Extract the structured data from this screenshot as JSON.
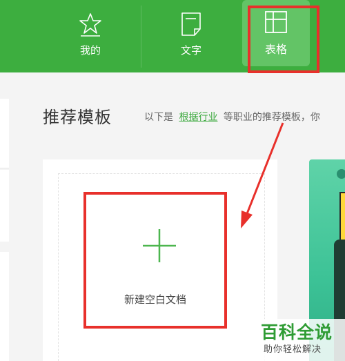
{
  "tabs": [
    {
      "label": "我的",
      "icon": "star-icon"
    },
    {
      "label": "文字",
      "icon": "document-icon"
    },
    {
      "label": "表格",
      "icon": "table-icon",
      "active": true
    }
  ],
  "section": {
    "title": "推荐模板",
    "subtitle_prefix": "以下是",
    "subtitle_link": "根据行业",
    "subtitle_suffix": "等职业的推荐模板，你"
  },
  "blank_template": {
    "label": "新建空白文档"
  },
  "watermark": {
    "title": "百科全说",
    "subtitle": "助你轻松解决"
  },
  "colors": {
    "brand_green": "#3dae3f",
    "active_tab": "#63c466",
    "highlight_red": "#e8302b",
    "link_green": "#3aa83c"
  }
}
